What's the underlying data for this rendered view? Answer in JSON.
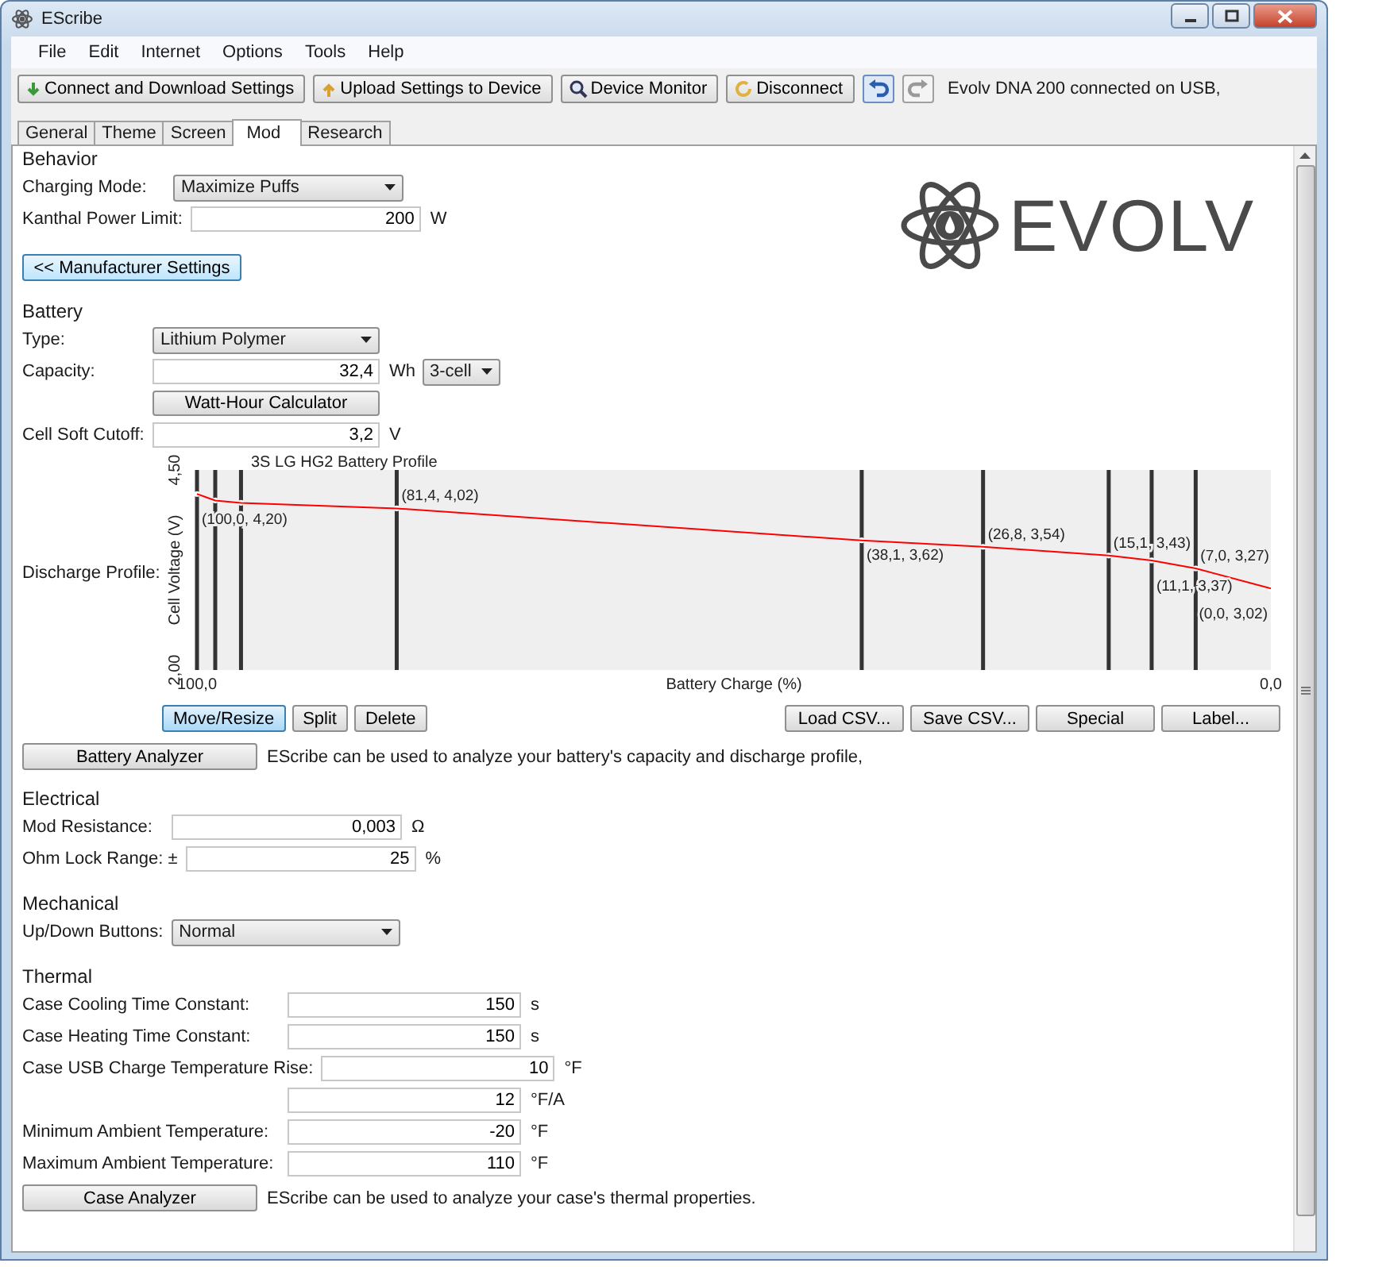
{
  "window": {
    "title": "EScribe"
  },
  "menu": [
    "File",
    "Edit",
    "Internet",
    "Options",
    "Tools",
    "Help"
  ],
  "toolbar": {
    "buttons": [
      {
        "kind": "download",
        "label": "Connect and Download Settings"
      },
      {
        "kind": "upload",
        "label": "Upload Settings to Device"
      },
      {
        "kind": "monitor",
        "label": "Device Monitor"
      },
      {
        "kind": "disconnect",
        "label": "Disconnect"
      },
      {
        "kind": "undo"
      },
      {
        "kind": "redo"
      }
    ],
    "status": "Evolv DNA 200 connected on USB,"
  },
  "tabs": [
    {
      "label": "General",
      "selected": false
    },
    {
      "label": "Theme",
      "selected": false
    },
    {
      "label": "Screen",
      "selected": false
    },
    {
      "label": "Mod",
      "selected": true
    },
    {
      "label": "Research",
      "selected": false
    }
  ],
  "logo": {
    "text": "EVOLV"
  },
  "behavior": {
    "title": "Behavior",
    "fields": [
      {
        "kind": "dropdown",
        "label": "Charging Mode:",
        "value": "Maximize Puffs"
      },
      {
        "kind": "input",
        "label": "Kanthal Power Limit:",
        "value": "200",
        "unit": "W"
      }
    ],
    "button": "<< Manufacturer Settings"
  },
  "battery": {
    "title": "Battery",
    "fields": [
      {
        "kind": "dropdown",
        "label": "Type:",
        "value": "Lithium Polymer"
      },
      {
        "kind": "input",
        "label": "Capacity:",
        "value": "32,4",
        "unit": "Wh",
        "extra_dropdown": "3-cell"
      },
      {
        "kind": "button",
        "value": "Watt-Hour Calculator"
      },
      {
        "kind": "input",
        "label": "Cell Soft Cutoff:",
        "value": "3,2",
        "unit": "V"
      }
    ],
    "profile": {
      "label": "Discharge Profile:",
      "chart_data": {
        "type": "line",
        "title": "3S LG HG2 Battery Profile",
        "xlabel": "Battery Charge (%)",
        "ylabel": "Cell Voltage (V)",
        "x": [
          100,
          98.3,
          95.9,
          81.4,
          38.1,
          26.8,
          15.1,
          11.1,
          7.0,
          0.0
        ],
        "series": [
          {
            "color": "#ff0000",
            "marker": "circle",
            "values": [
              4.2,
              4.12,
              4.09,
              4.02,
              3.62,
              3.54,
              3.43,
              3.37,
              3.27,
              3.02
            ]
          }
        ],
        "xlim": [
          100,
          0
        ],
        "ylim": [
          2,
          4.5
        ],
        "xticks": [
          {
            "value": 100,
            "label": "100,0"
          },
          {
            "value": 0,
            "label": "0,0"
          }
        ],
        "yticks": [
          {
            "value": 2,
            "label": "2,00"
          },
          {
            "value": 4.5,
            "label": "4,50"
          }
        ],
        "annotations": [
          {
            "x": 100,
            "y": 4.2,
            "text": "(100,0, 4,20)"
          },
          {
            "x": 81.4,
            "y": 4.02,
            "text": "(81,4, 4,02)"
          },
          {
            "x": 38.1,
            "y": 3.62,
            "text": "(38,1, 3,62)"
          },
          {
            "x": 26.8,
            "y": 3.54,
            "text": "(26,8, 3,54)"
          },
          {
            "x": 15.1,
            "y": 3.43,
            "text": "(15,1, 3,43)"
          },
          {
            "x": 11.1,
            "y": 3.37,
            "text": "(11,1, 3,37)"
          },
          {
            "x": 7.0,
            "y": 3.27,
            "text": "(7,0, 3,27)"
          },
          {
            "x": 0.0,
            "y": 3.02,
            "text": "(0,0, 3,02)"
          }
        ]
      },
      "tools": [
        {
          "label": "Move/Resize",
          "selected": true
        },
        {
          "label": "Split",
          "selected": false
        },
        {
          "label": "Delete",
          "selected": false
        }
      ],
      "actions": [
        "Load CSV...",
        "Save CSV...",
        "Special",
        "Label..."
      ]
    },
    "analyzer": {
      "button": "Battery Analyzer",
      "description": "EScribe can be used to analyze your battery's capacity and discharge profile,"
    }
  },
  "electrical": {
    "title": "Electrical",
    "fields": [
      {
        "kind": "input",
        "label": "Mod Resistance:",
        "value": "0,003",
        "unit": "Ω"
      },
      {
        "kind": "input",
        "label": "Ohm Lock Range: ±",
        "value": "25",
        "unit": "%"
      }
    ]
  },
  "mechanical": {
    "title": "Mechanical",
    "fields": [
      {
        "kind": "dropdown",
        "label": "Up/Down Buttons:",
        "value": "Normal"
      }
    ]
  },
  "thermal": {
    "title": "Thermal",
    "fields": [
      {
        "kind": "input",
        "label": "Case Cooling Time Constant:",
        "value": "150",
        "unit": "s"
      },
      {
        "kind": "input",
        "label": "Case Heating Time Constant:",
        "value": "150",
        "unit": "s"
      },
      {
        "kind": "input",
        "label": "Case USB Charge Temperature Rise:",
        "value": "10",
        "unit": "°F"
      },
      {
        "kind": "input",
        "value": "12",
        "unit": "°F/A"
      },
      {
        "kind": "input",
        "label": "Minimum Ambient Temperature:",
        "value": "-20",
        "unit": "°F"
      },
      {
        "kind": "input",
        "label": "Maximum Ambient Temperature:",
        "value": "110",
        "unit": "°F"
      }
    ],
    "analyzer": {
      "button": "Case Analyzer",
      "description": "EScribe can be used to analyze your case's thermal properties."
    }
  }
}
